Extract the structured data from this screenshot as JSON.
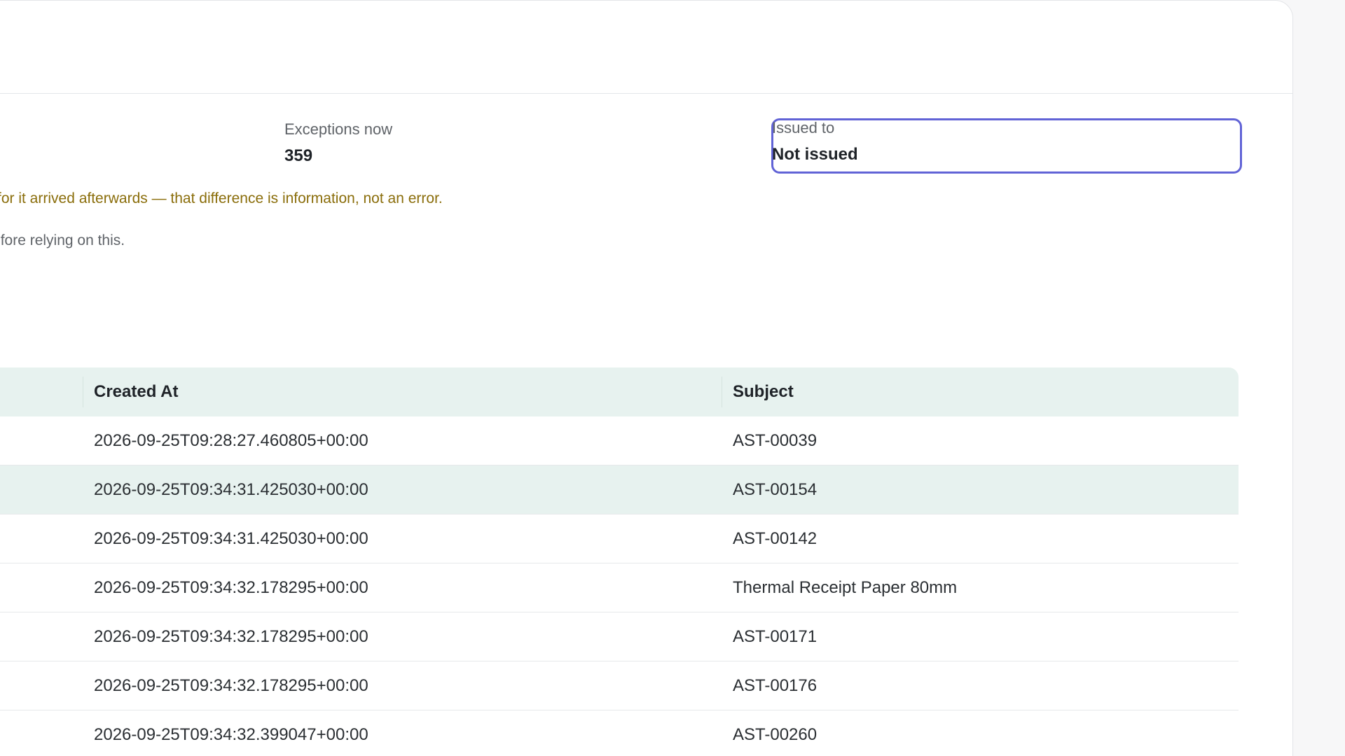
{
  "edge_char": "‹",
  "stats": {
    "exceptions": {
      "label": "Exceptions now",
      "value": "359"
    },
    "issued": {
      "label": "Issued to",
      "value": "Not issued"
    }
  },
  "notice": "rds for it arrived afterwards — that difference is information, not an error.",
  "hint": "s before relying on this.",
  "table": {
    "columns": [
      "Created At",
      "Subject"
    ],
    "rows": [
      {
        "created_at": "2026-09-25T09:28:27.460805+00:00",
        "subject": "AST-00039"
      },
      {
        "created_at": "2026-09-25T09:34:31.425030+00:00",
        "subject": "AST-00154"
      },
      {
        "created_at": "2026-09-25T09:34:31.425030+00:00",
        "subject": "AST-00142"
      },
      {
        "created_at": "2026-09-25T09:34:32.178295+00:00",
        "subject": "Thermal Receipt Paper 80mm"
      },
      {
        "created_at": "2026-09-25T09:34:32.178295+00:00",
        "subject": "AST-00171"
      },
      {
        "created_at": "2026-09-25T09:34:32.178295+00:00",
        "subject": "AST-00176"
      },
      {
        "created_at": "2026-09-25T09:34:32.399047+00:00",
        "subject": "AST-00260"
      }
    ],
    "highlighted_row": 1
  }
}
